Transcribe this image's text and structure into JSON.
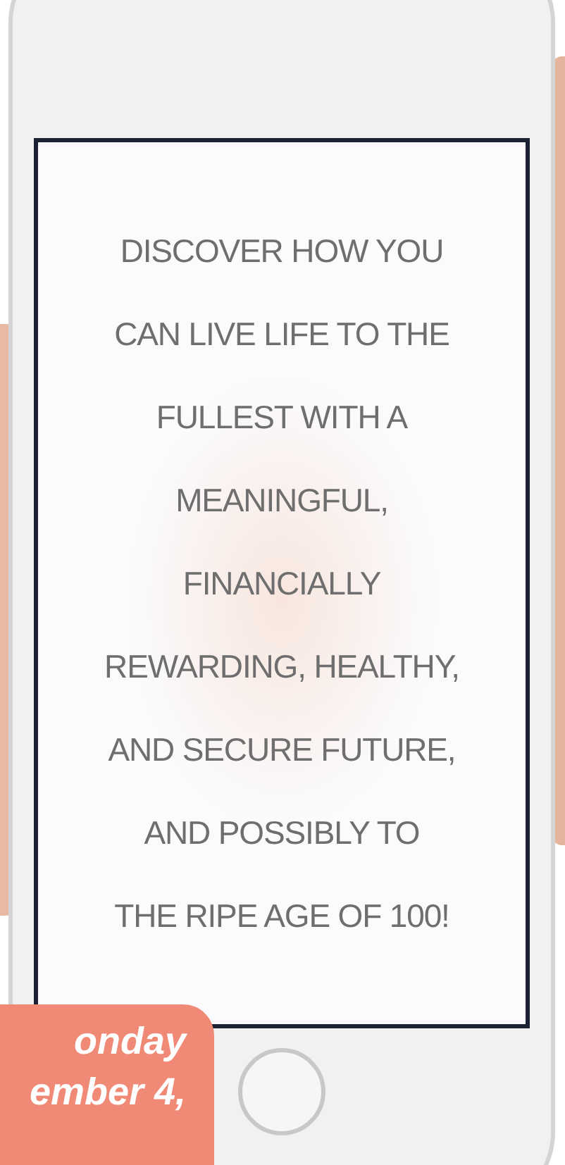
{
  "screen": {
    "message_lines": [
      "DISCOVER HOW YOU",
      "CAN LIVE LIFE TO THE",
      "FULLEST WITH A",
      "MEANINGFUL,",
      "FINANCIALLY",
      "REWARDING, HEALTHY,",
      "AND SECURE FUTURE,",
      "AND POSSIBLY TO",
      "THE RIPE AGE OF 100!"
    ]
  },
  "date_badge": {
    "lines": [
      "onday",
      "ember 4,"
    ]
  }
}
